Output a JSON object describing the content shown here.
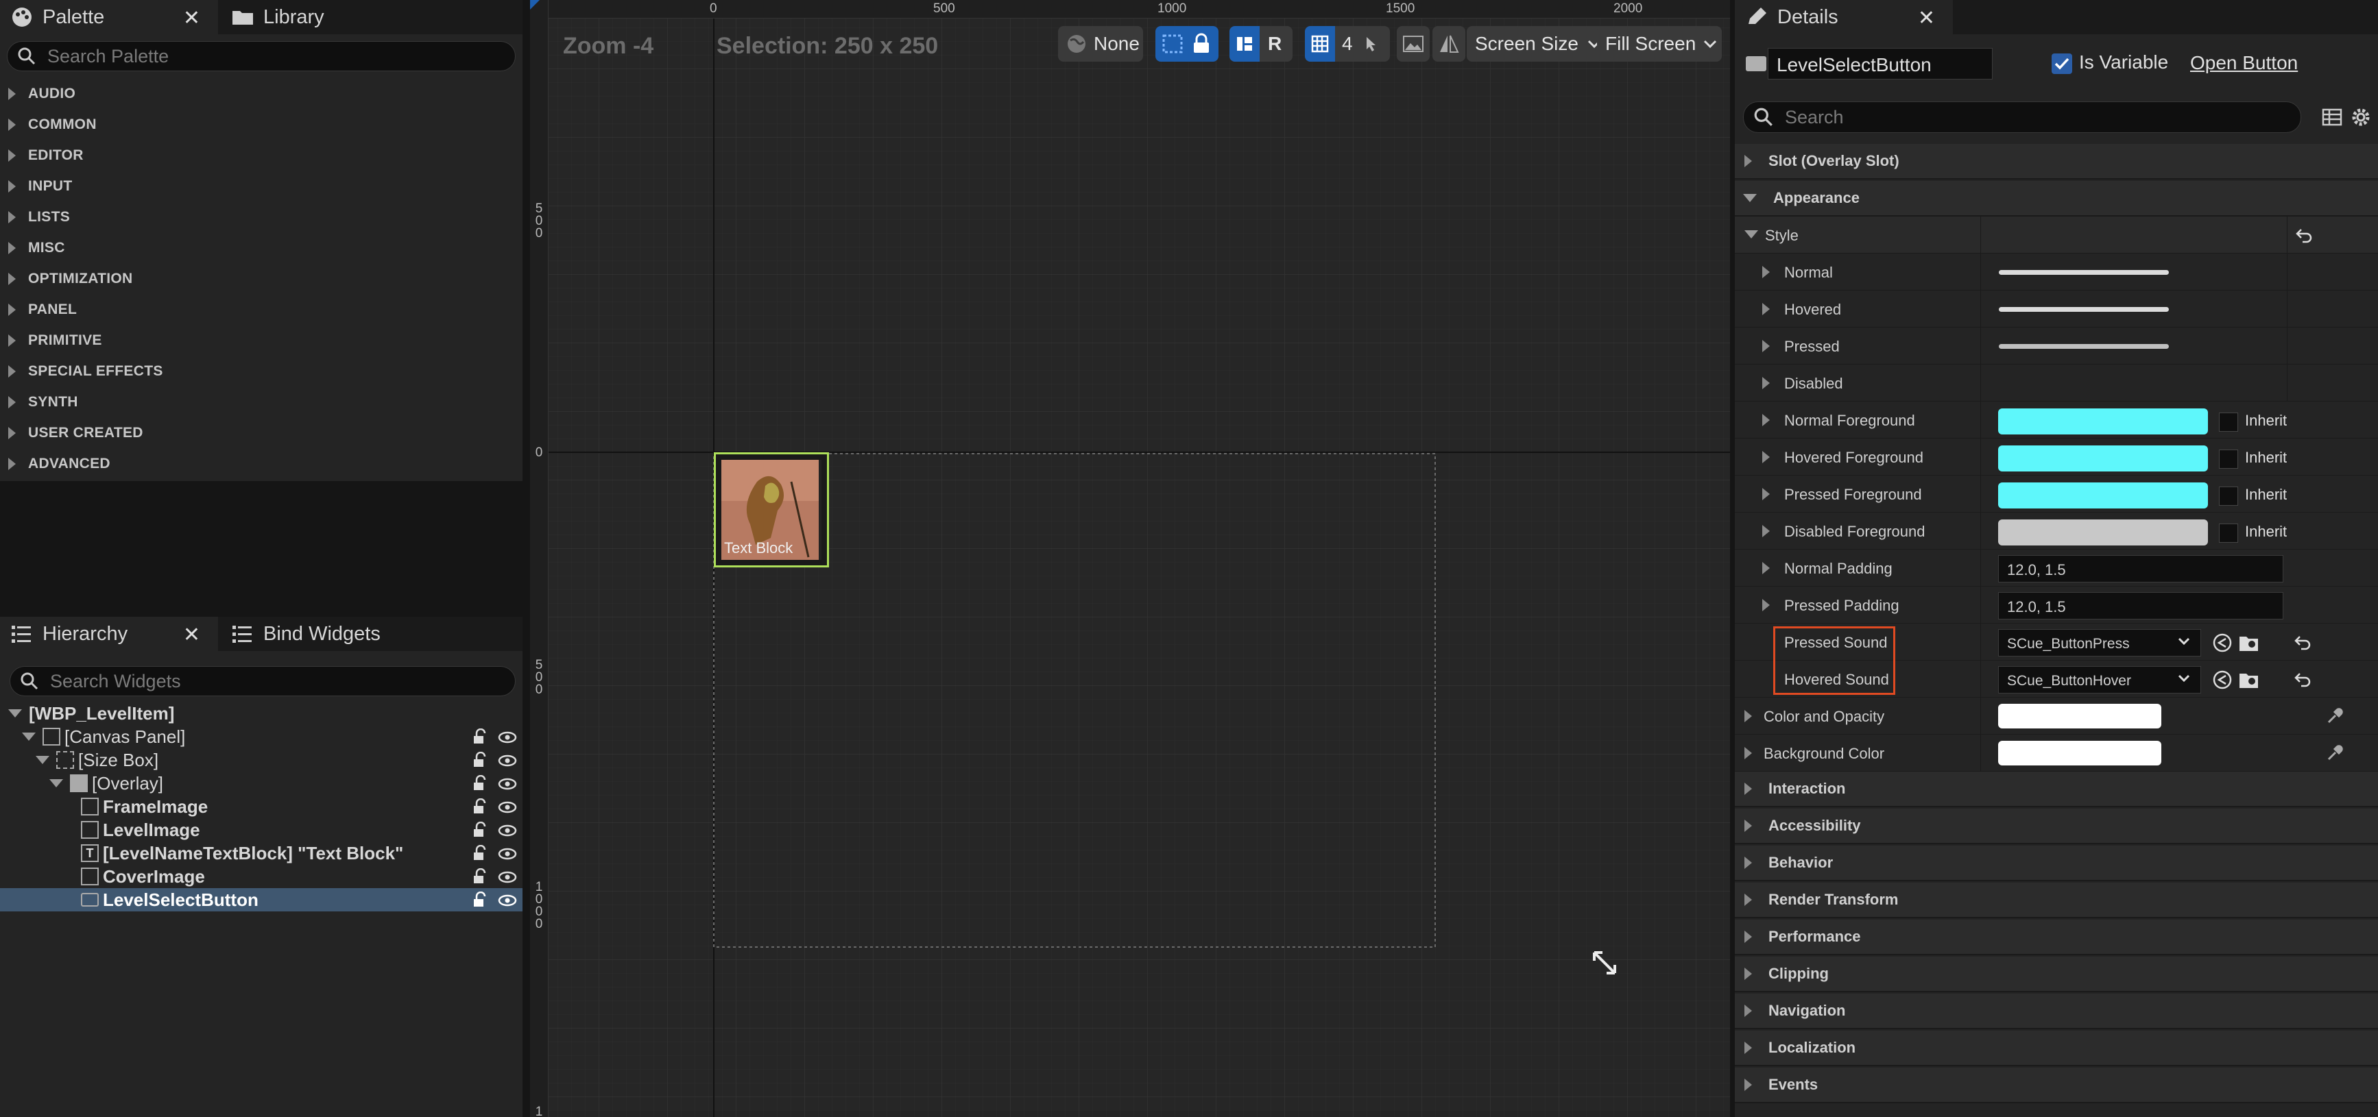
{
  "palette": {
    "tab_palette": "Palette",
    "tab_library": "Library",
    "search_placeholder": "Search Palette",
    "categories": [
      "AUDIO",
      "COMMON",
      "EDITOR",
      "INPUT",
      "LISTS",
      "MISC",
      "OPTIMIZATION",
      "PANEL",
      "PRIMITIVE",
      "SPECIAL EFFECTS",
      "SYNTH",
      "USER CREATED",
      "ADVANCED"
    ]
  },
  "hierarchy": {
    "tab_hierarchy": "Hierarchy",
    "tab_bind": "Bind Widgets",
    "search_placeholder": "Search Widgets",
    "items": [
      {
        "label": "[WBP_LevelItem]"
      },
      {
        "label": "[Canvas Panel]"
      },
      {
        "label": "[Size Box]"
      },
      {
        "label": "[Overlay]"
      },
      {
        "label": "FrameImage"
      },
      {
        "label": "LevelImage"
      },
      {
        "label": "[LevelNameTextBlock] \"Text Block\""
      },
      {
        "label": "CoverImage"
      },
      {
        "label": "LevelSelectButton"
      }
    ],
    "text_icon_glyph": "T"
  },
  "viewport": {
    "zoom": "Zoom -4",
    "selection": "Selection: 250 x 250",
    "ruler_top": [
      "0",
      "500",
      "1000",
      "1500",
      "2000"
    ],
    "ruler_left": [
      "5 0 0",
      "0",
      "5 0 0",
      "1 0 0 0",
      "1"
    ],
    "toolbar": {
      "none_label": "None",
      "r_label": "R",
      "grid_count": "4",
      "screen_size": "Screen Size",
      "fill_screen": "Fill Screen"
    },
    "widget_text": "Text Block"
  },
  "details": {
    "tab_title": "Details",
    "widget_name": "LevelSelectButton",
    "is_variable_label": "Is Variable",
    "is_variable": true,
    "open_button": "Open Button",
    "search_placeholder": "Search",
    "sections": {
      "slot": "Slot (Overlay Slot)",
      "appearance": "Appearance",
      "style": "Style",
      "color_opacity": "Color and Opacity",
      "background_color": "Background Color",
      "interaction": "Interaction",
      "accessibility": "Accessibility",
      "behavior": "Behavior",
      "render_transform": "Render Transform",
      "performance": "Performance",
      "clipping": "Clipping",
      "navigation": "Navigation",
      "localization": "Localization",
      "events": "Events"
    },
    "style_rows": {
      "normal": "Normal",
      "hovered": "Hovered",
      "pressed": "Pressed",
      "disabled": "Disabled",
      "normal_fg": "Normal Foreground",
      "hovered_fg": "Hovered Foreground",
      "pressed_fg": "Pressed Foreground",
      "disabled_fg": "Disabled Foreground",
      "inherit": "Inherit",
      "normal_padding": "Normal Padding",
      "normal_padding_value": "12.0, 1.5",
      "pressed_padding": "Pressed Padding",
      "pressed_padding_value": "12.0, 1.5",
      "pressed_sound": "Pressed Sound",
      "pressed_sound_value": "SCue_ButtonPress",
      "hovered_sound": "Hovered Sound",
      "hovered_sound_value": "SCue_ButtonHover"
    },
    "colors": {
      "foreground_cyan": "#5ef7fb",
      "disabled_fg": "#c8c8c8",
      "highlight_box": "#e04a22",
      "selection_green": "#aee05a",
      "accent_blue": "#1d5fb0"
    }
  }
}
